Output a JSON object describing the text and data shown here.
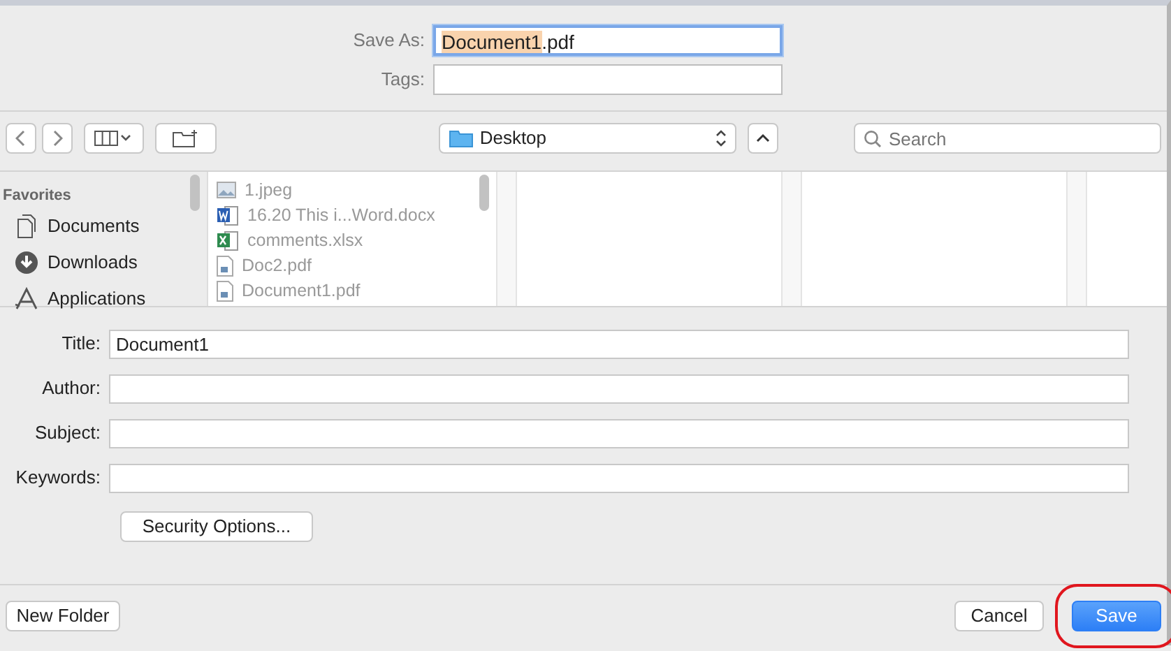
{
  "save_as": {
    "label": "Save As:",
    "parts": [
      {
        "text": "Document1",
        "selected": true
      },
      {
        "text": ".pdf",
        "selected": false
      }
    ],
    "focused": true
  },
  "tags": {
    "label": "Tags:"
  },
  "location": {
    "label": "Desktop"
  },
  "search": {
    "placeholder": "Search"
  },
  "sidebar": {
    "heading": "Favorites",
    "items": [
      {
        "kind": "documents",
        "label": "Documents"
      },
      {
        "kind": "downloads",
        "label": "Downloads"
      },
      {
        "kind": "applications",
        "label": "Applications"
      }
    ]
  },
  "files": [
    {
      "kind": "image",
      "name": "1.jpeg"
    },
    {
      "kind": "word",
      "name": "16.20 This i...Word.docx"
    },
    {
      "kind": "excel",
      "name": "comments.xlsx"
    },
    {
      "kind": "pdf",
      "name": "Doc2.pdf"
    },
    {
      "kind": "pdf",
      "name": "Document1.pdf"
    }
  ],
  "fields": [
    {
      "label": "Title:",
      "value": "Document1"
    },
    {
      "label": "Author:"
    },
    {
      "label": "Subject:"
    },
    {
      "label": "Keywords:"
    }
  ],
  "security_button": "Security Options...",
  "buttons": [
    {
      "kind": "secondary",
      "label": "New Folder"
    },
    {
      "kind": "secondary",
      "label": "Cancel"
    },
    {
      "kind": "default",
      "label": "Save",
      "highlighted": true
    }
  ]
}
